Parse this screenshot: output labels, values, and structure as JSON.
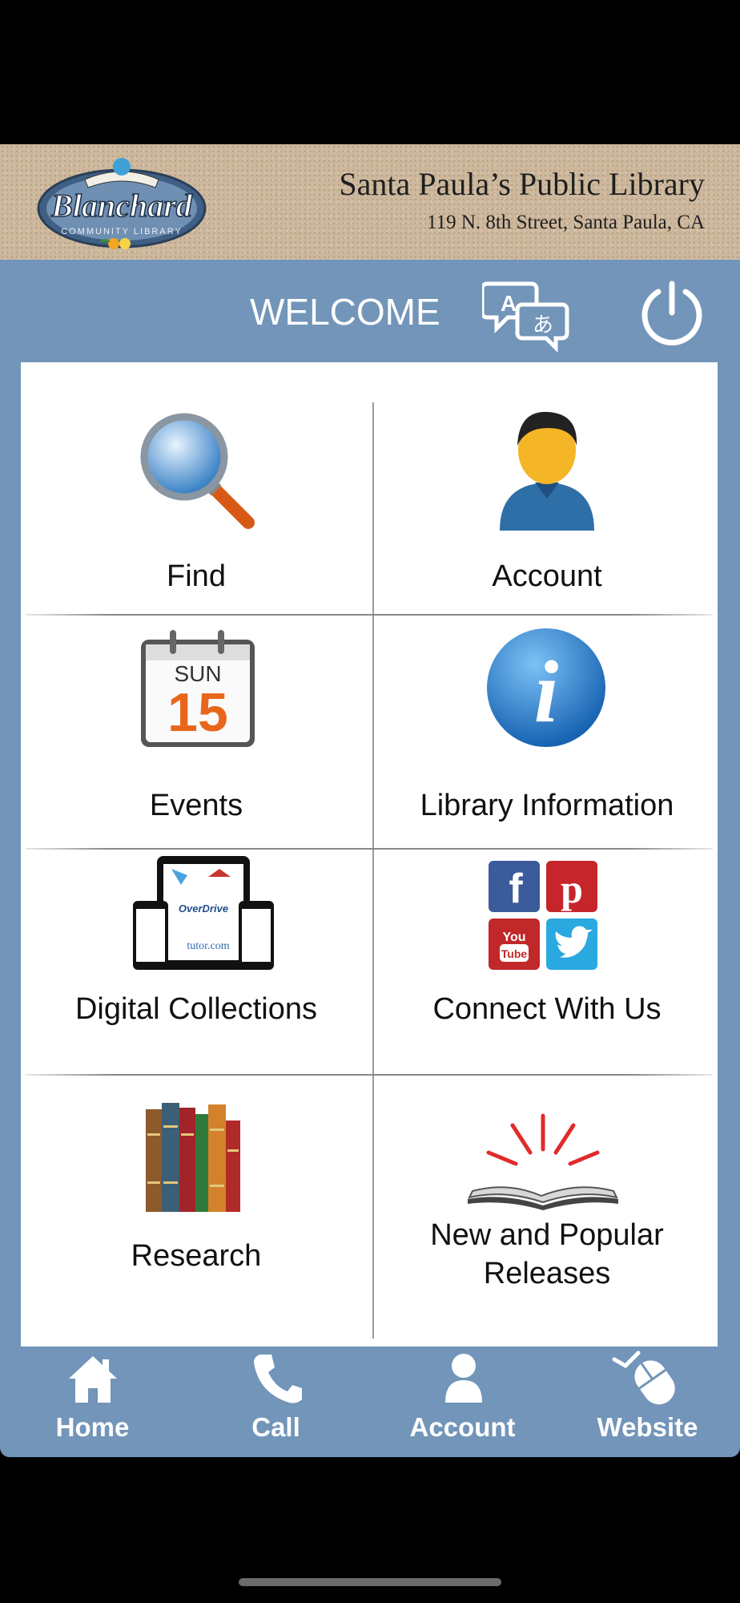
{
  "header": {
    "library_name": "Santa Paula’s Public Library",
    "address": "119 N. 8th Street, Santa Paula, CA",
    "logo_text": "Blanchard",
    "logo_subtext": "COMMUNITY LIBRARY"
  },
  "welcome_bar": {
    "title": "WELCOME",
    "language_icon": "translate-icon",
    "power_icon": "power-icon"
  },
  "grid": [
    {
      "label": "Find",
      "icon": "magnifier-icon"
    },
    {
      "label": "Account",
      "icon": "user-icon"
    },
    {
      "label": "Events",
      "icon": "calendar-icon",
      "calendar_day": "SUN",
      "calendar_date": "15"
    },
    {
      "label": "Library Information",
      "icon": "info-icon"
    },
    {
      "label": "Digital Collections",
      "icon": "devices-icon"
    },
    {
      "label": "Connect With Us",
      "icon": "social-icons"
    },
    {
      "label": "Research",
      "icon": "books-icon"
    },
    {
      "label": "New and Popular",
      "label2": "Releases",
      "icon": "open-book-icon"
    }
  ],
  "bottom_nav": [
    {
      "label": "Home",
      "icon": "home-icon"
    },
    {
      "label": "Call",
      "icon": "phone-icon"
    },
    {
      "label": "Account",
      "icon": "user-icon"
    },
    {
      "label": "Website",
      "icon": "mouse-icon"
    }
  ],
  "colors": {
    "bar": "#7295b9",
    "panel": "#ffffff",
    "accent_orange": "#e8661c"
  }
}
